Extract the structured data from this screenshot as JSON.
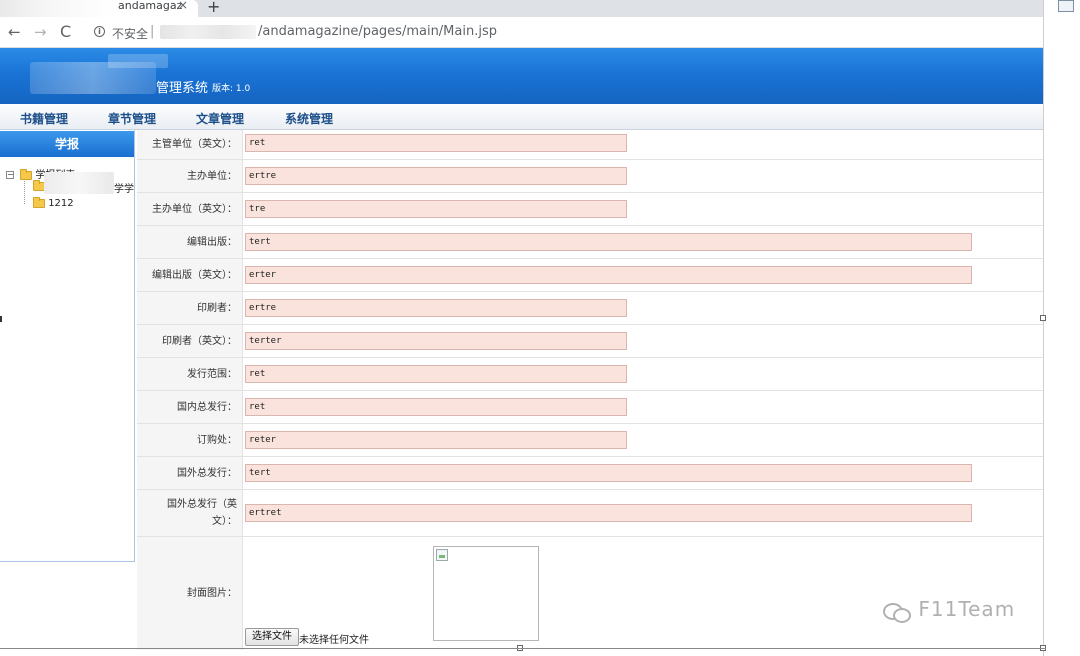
{
  "browser": {
    "tab_title": "andamagaz",
    "tab_close": "×",
    "new_tab": "+",
    "back": "←",
    "forward": "→",
    "reload": "C",
    "info": "i",
    "security_label": "不安全",
    "separator": "|",
    "url": "/andamagazine/pages/main/Main.jsp"
  },
  "header": {
    "title": "管理系统",
    "version": "版本: 1.0"
  },
  "menu": [
    {
      "label": "书籍管理"
    },
    {
      "label": "章节管理"
    },
    {
      "label": "文章管理"
    },
    {
      "label": "系统管理"
    }
  ],
  "sidebar": {
    "title": "学报",
    "tree": {
      "root_toggle": "−",
      "root_label": "学报列表",
      "child1_label": "学学",
      "child2_label": "1212"
    }
  },
  "form": {
    "rows": [
      {
        "label": "主管单位（英文）：",
        "value": "ret"
      },
      {
        "label": "主办单位：",
        "value": "ertre"
      },
      {
        "label": "主办单位（英文）：",
        "value": "tre"
      },
      {
        "label": "编辑出版：",
        "value": "tert"
      },
      {
        "label": "编辑出版（英文）：",
        "value": "erter"
      },
      {
        "label": "印刷者：",
        "value": "ertre"
      },
      {
        "label": "印刷者（英文）：",
        "value": "terter"
      },
      {
        "label": "发行范围：",
        "value": "ret"
      },
      {
        "label": "国内总发行：",
        "value": "ret"
      },
      {
        "label": "订购处：",
        "value": "reter"
      },
      {
        "label": "国外总发行：",
        "value": "tert"
      },
      {
        "label": "国外总发行（英文）：",
        "value": "ertret"
      }
    ],
    "cover": {
      "label": "封面图片：",
      "file_button": "选择文件",
      "file_status": "未选择任何文件"
    }
  },
  "watermark": "F11Team"
}
